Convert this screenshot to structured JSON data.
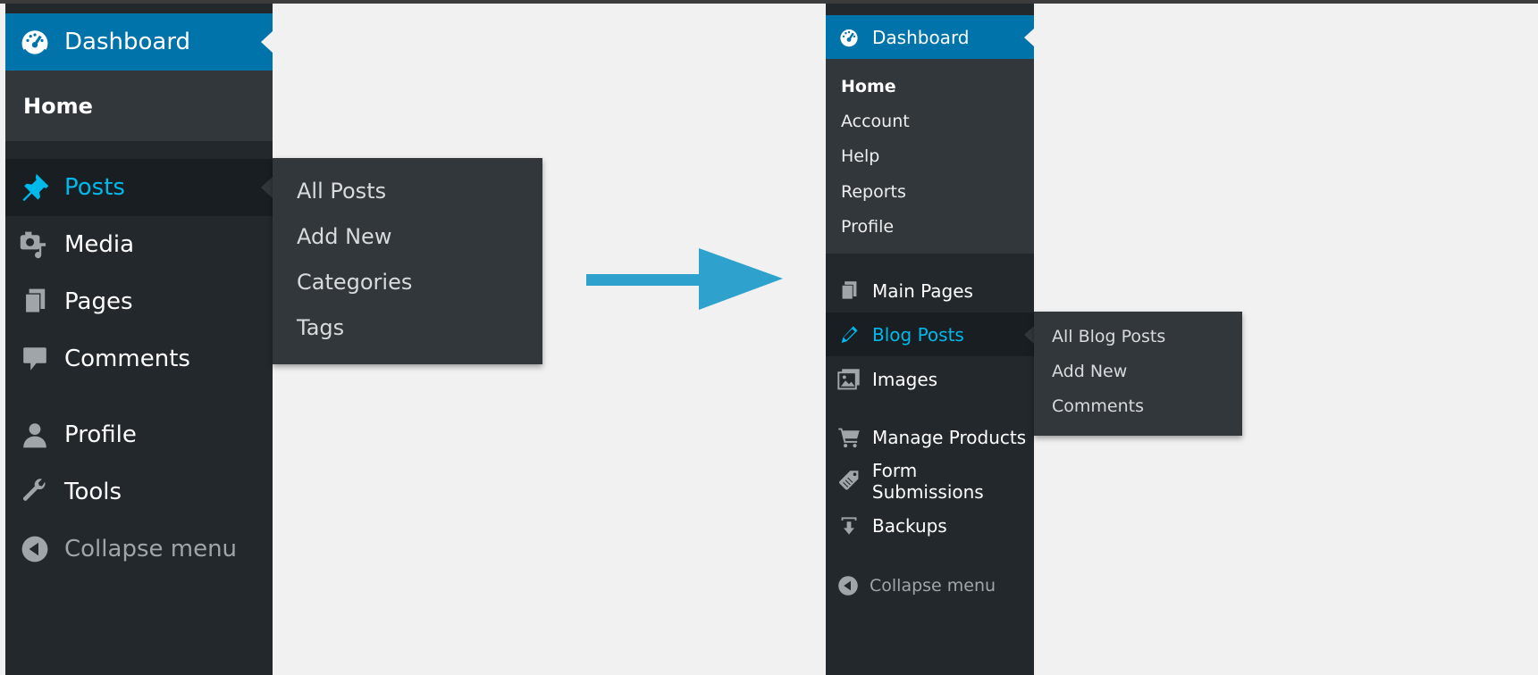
{
  "left_menu": {
    "dashboard": {
      "label": "Dashboard",
      "icon": "dashboard-gauge-icon"
    },
    "submenu": {
      "home": "Home"
    },
    "items": [
      {
        "label": "Posts",
        "icon": "pin-icon",
        "active": true
      },
      {
        "label": "Media",
        "icon": "media-icon"
      },
      {
        "label": "Pages",
        "icon": "pages-icon"
      },
      {
        "label": "Comments",
        "icon": "comment-bubble-icon"
      },
      {
        "label": "Profile",
        "icon": "user-icon"
      },
      {
        "label": "Tools",
        "icon": "wrench-icon"
      },
      {
        "label": "Collapse menu",
        "icon": "collapse-arrow-icon"
      }
    ],
    "flyout": [
      "All Posts",
      "Add New",
      "Categories",
      "Tags"
    ]
  },
  "right_menu": {
    "dashboard": {
      "label": "Dashboard",
      "icon": "dashboard-gauge-icon"
    },
    "submenu": [
      "Home",
      "Account",
      "Help",
      "Reports",
      "Profile"
    ],
    "items": [
      {
        "label": "Main Pages",
        "icon": "pages-icon"
      },
      {
        "label": "Blog Posts",
        "icon": "pencil-icon",
        "active": true
      },
      {
        "label": "Images",
        "icon": "images-icon"
      },
      {
        "label": "Manage Products",
        "icon": "cart-icon"
      },
      {
        "label": "Form Submissions",
        "icon": "tag-icon"
      },
      {
        "label": "Backups",
        "icon": "download-icon"
      },
      {
        "label": "Collapse menu",
        "icon": "collapse-arrow-icon"
      }
    ],
    "flyout": [
      "All Blog Posts",
      "Add New",
      "Comments"
    ]
  },
  "colors": {
    "accent_blue": "#0073aa",
    "active_text": "#00b9eb",
    "menu_bg": "#23282d",
    "submenu_bg": "#32373c",
    "arrow": "#2ea2cc"
  }
}
